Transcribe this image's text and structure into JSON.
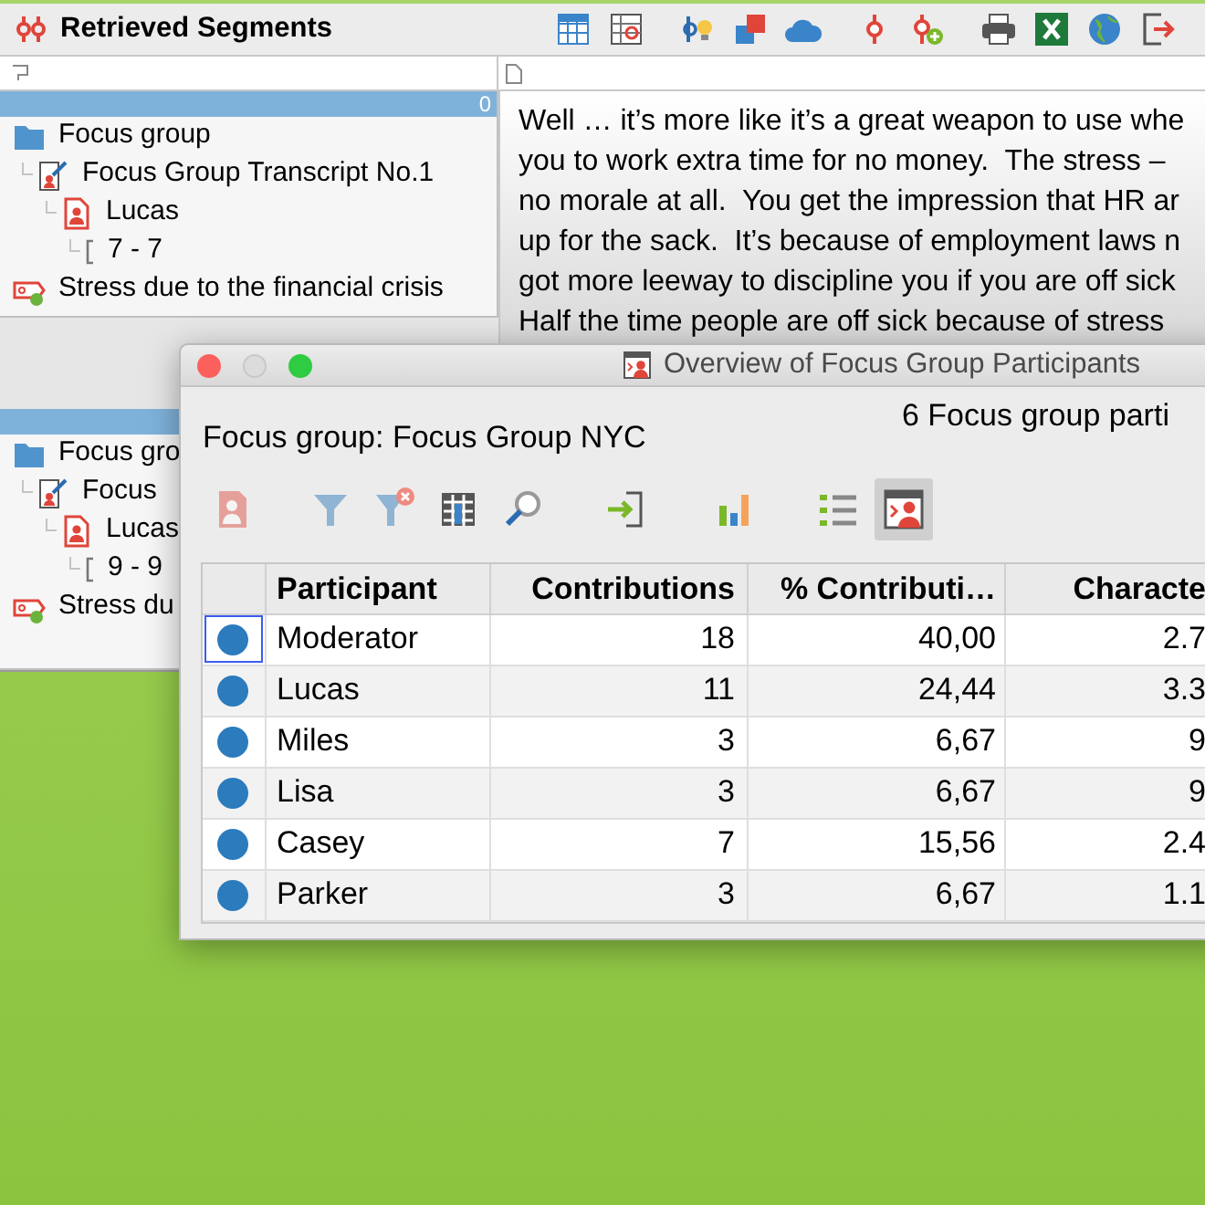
{
  "main_window": {
    "title": "Retrieved Segments"
  },
  "segment_panels": [
    {
      "count": "0",
      "tree": [
        {
          "kind": "folder",
          "label": "Focus group",
          "children": [
            {
              "kind": "document",
              "label": "Focus Group Transcript No.1",
              "children": [
                {
                  "kind": "speaker",
                  "label": "Lucas",
                  "children": [
                    {
                      "kind": "range",
                      "label": "7 - 7"
                    }
                  ]
                }
              ]
            }
          ]
        },
        {
          "kind": "code",
          "label": "Stress due to the financial crisis"
        }
      ]
    },
    {
      "tree": [
        {
          "kind": "folder",
          "label": "Focus gro",
          "children": [
            {
              "kind": "document",
              "label": "Focus",
              "children": [
                {
                  "kind": "speaker",
                  "label": "Lucas",
                  "children": [
                    {
                      "kind": "range",
                      "label": "9 - 9"
                    }
                  ]
                }
              ]
            }
          ]
        },
        {
          "kind": "code",
          "label": "Stress du"
        }
      ]
    }
  ],
  "text_lines": [
    "Well … it’s more like it’s a great weapon to use whe",
    "you to work extra time for no money.  The stress –",
    "no morale at all.  You get the impression that HR ar",
    "up for the sack.  It’s because of employment laws n",
    "got more leeway to discipline you if you are off sick",
    "Half the time people are off sick because of stress"
  ],
  "dialog": {
    "title": "Overview of Focus Group Participants",
    "focus_group": "Focus group: Focus Group NYC",
    "summary": "6 Focus group parti",
    "toolbar": [
      {
        "kind": "participant",
        "disabled": true,
        "selected": false
      },
      {
        "kind": "filter",
        "disabled": false,
        "selected": false
      },
      {
        "kind": "filter-clear",
        "disabled": false,
        "selected": false
      },
      {
        "kind": "grid",
        "disabled": false,
        "selected": false
      },
      {
        "kind": "search",
        "disabled": false,
        "selected": false
      },
      {
        "kind": "import",
        "disabled": false,
        "selected": false
      },
      {
        "kind": "chart",
        "disabled": false,
        "selected": false
      },
      {
        "kind": "list",
        "disabled": false,
        "selected": false
      },
      {
        "kind": "participants",
        "disabled": false,
        "selected": true
      }
    ],
    "table": {
      "columns": [
        "Participant",
        "Contributions",
        "% Contributi…",
        "Characte"
      ],
      "rows": [
        {
          "color": "#2b7bbd",
          "focused": true,
          "cells": [
            "Moderator",
            "18",
            "40,00",
            "2.7"
          ]
        },
        {
          "color": "#2b7bbd",
          "focused": false,
          "cells": [
            "Lucas",
            "11",
            "24,44",
            "3.3"
          ]
        },
        {
          "color": "#2b7bbd",
          "focused": false,
          "cells": [
            "Miles",
            "3",
            "6,67",
            "9"
          ]
        },
        {
          "color": "#2b7bbd",
          "focused": false,
          "cells": [
            "Lisa",
            "3",
            "6,67",
            "9"
          ]
        },
        {
          "color": "#2b7bbd",
          "focused": false,
          "cells": [
            "Casey",
            "7",
            "15,56",
            "2.4"
          ]
        },
        {
          "color": "#2b7bbd",
          "focused": false,
          "cells": [
            "Parker",
            "3",
            "6,67",
            "1.1"
          ]
        }
      ]
    }
  }
}
